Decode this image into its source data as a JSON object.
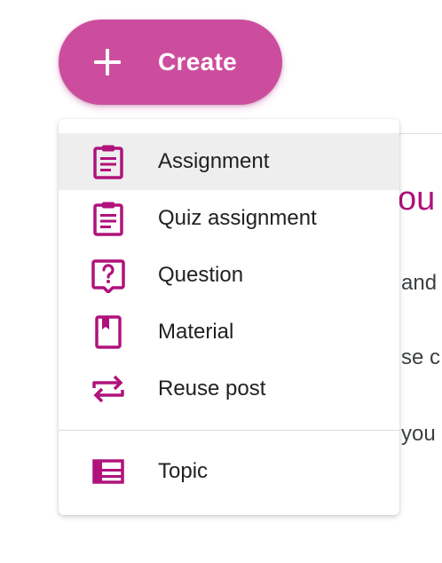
{
  "create_button": {
    "label": "Create"
  },
  "menu": {
    "items": [
      {
        "label": "Assignment",
        "icon": "assignment-icon"
      },
      {
        "label": "Quiz assignment",
        "icon": "quiz-assignment-icon"
      },
      {
        "label": "Question",
        "icon": "question-icon"
      },
      {
        "label": "Material",
        "icon": "material-icon"
      },
      {
        "label": "Reuse post",
        "icon": "reuse-post-icon"
      }
    ],
    "topic": {
      "label": "Topic",
      "icon": "topic-icon"
    }
  },
  "background": {
    "heading_fragment": "ou",
    "line1_fragment": "and",
    "line2_fragment": "se c",
    "line3_fragment": "you"
  },
  "colors": {
    "accent": "#b0127c",
    "button": "#cc4d9e",
    "highlight": "#eeeeee"
  }
}
